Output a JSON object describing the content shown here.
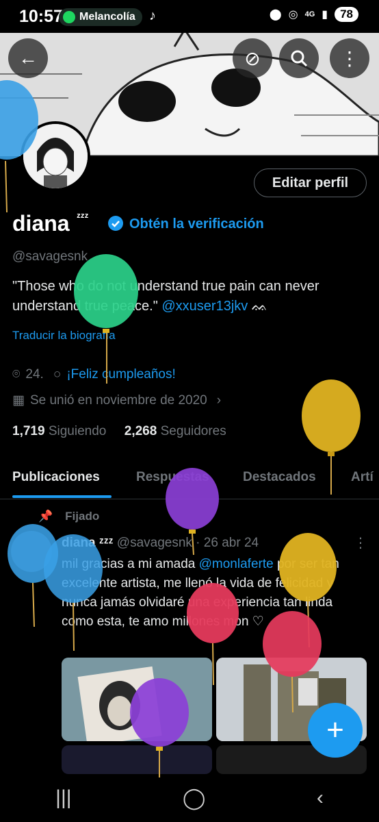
{
  "status_bar": {
    "time": "10:57",
    "music": "Melancolía",
    "network": "4G",
    "battery": "78"
  },
  "header": {
    "back_icon": "arrow-left-icon",
    "icons": [
      "no-sync-icon",
      "search-icon",
      "more-vertical-icon"
    ]
  },
  "profile": {
    "edit_label": "Editar perfil",
    "name": "diana",
    "name_suffix": "ᶻᶻᶻ",
    "verify_label": "Obtén la verificación",
    "handle": "@savagesnk",
    "bio_text": "\"Those who do not understand true pain can never understand true peace.\"",
    "bio_mention": "@xxuser13jkv",
    "bio_emoji": "ᨐ",
    "translate_label": "Traducir la biografía",
    "location": "24.",
    "birthday": "¡Feliz cumpleaños!",
    "joined": "Se unió en noviembre de 2020",
    "following_count": "1,719",
    "following_label": "Siguiendo",
    "followers_count": "2,268",
    "followers_label": "Seguidores"
  },
  "tabs": [
    {
      "label": "Publicaciones",
      "active": true
    },
    {
      "label": "Respuestas"
    },
    {
      "label": "Destacados"
    },
    {
      "label": "Artí"
    }
  ],
  "post": {
    "pinned_label": "Fijado",
    "author": "diana ᶻᶻᶻ",
    "handle_date": "@savagesnk · 26 abr 24",
    "text_before": "mil gracias a mi amada",
    "mention": "@monlaferte",
    "text_after": "por ser tan excelente artista, me llenó la vida de felicidad y nunca jamás olvidaré una experiencia tan linda como esta, te amo millones mon ♡"
  },
  "colors": {
    "accent": "#1d9bf0",
    "muted": "#71767b",
    "balloon_blue": "#3aa0e6",
    "balloon_green": "#2bd18a",
    "balloon_gold": "#e0b321",
    "balloon_purple": "#8b3fd6",
    "balloon_red": "#e53a5c"
  }
}
